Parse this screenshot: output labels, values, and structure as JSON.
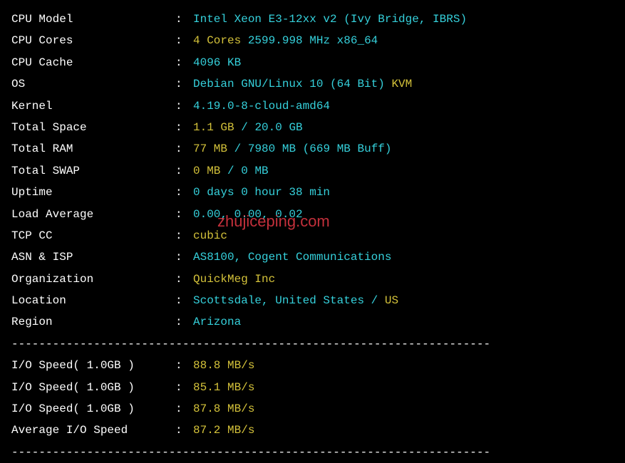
{
  "system": {
    "cpu_model": {
      "label": "CPU Model",
      "value": "Intel Xeon E3-12xx v2 (Ivy Bridge, IBRS)"
    },
    "cpu_cores": {
      "label": "CPU Cores",
      "cores": "4 Cores",
      "freq": "2599.998 MHz",
      "arch": "x86_64"
    },
    "cpu_cache": {
      "label": "CPU Cache",
      "value": "4096 KB"
    },
    "os": {
      "label": "OS",
      "name": "Debian GNU/Linux 10 (64 Bit)",
      "virt": "KVM"
    },
    "kernel": {
      "label": "Kernel",
      "value": "4.19.0-8-cloud-amd64"
    },
    "total_space": {
      "label": "Total Space",
      "used": "1.1 GB",
      "total": "20.0 GB"
    },
    "total_ram": {
      "label": "Total RAM",
      "used": "77 MB",
      "total": "7980 MB",
      "buff": "669 MB Buff"
    },
    "total_swap": {
      "label": "Total SWAP",
      "used": "0 MB",
      "total": "0 MB"
    },
    "uptime": {
      "label": "Uptime",
      "value": "0 days 0 hour 38 min"
    },
    "load_avg": {
      "label": "Load Average",
      "value": "0.00, 0.00, 0.02"
    },
    "tcp_cc": {
      "label": "TCP CC",
      "value": "cubic"
    },
    "asn_isp": {
      "label": "ASN & ISP",
      "value": "AS8100, Cogent Communications"
    },
    "organization": {
      "label": "Organization",
      "value": "QuickMeg Inc"
    },
    "location": {
      "label": "Location",
      "place": "Scottsdale, United States",
      "code": "US"
    },
    "region": {
      "label": "Region",
      "value": "Arizona"
    }
  },
  "io": {
    "tests": [
      {
        "label": "I/O Speed( 1.0GB )",
        "value": "88.8 MB/s"
      },
      {
        "label": "I/O Speed( 1.0GB )",
        "value": "85.1 MB/s"
      },
      {
        "label": "I/O Speed( 1.0GB )",
        "value": "87.8 MB/s"
      }
    ],
    "average": {
      "label": "Average I/O Speed",
      "value": "87.2 MB/s"
    }
  },
  "divider": "----------------------------------------------------------------------",
  "watermark": "zhujiceping.com"
}
